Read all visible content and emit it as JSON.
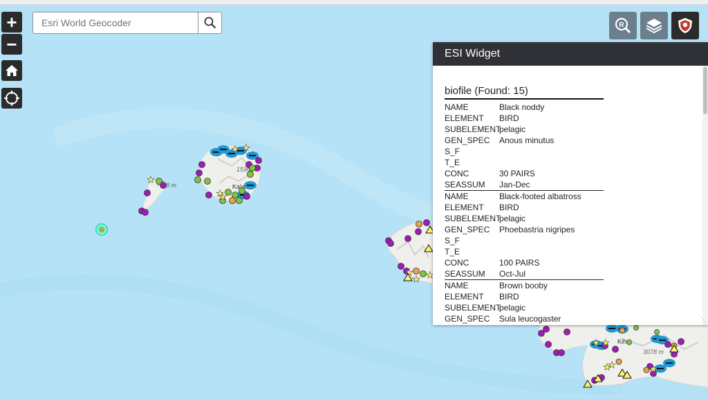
{
  "search": {
    "placeholder": "Esri World Geocoder"
  },
  "controls": {
    "zoom_in": "+",
    "zoom_out": "−"
  },
  "map_labels": {
    "elevation_1": "1596",
    "elevation_2": "98 m",
    "elevation_3": "3078 m",
    "town_1": "Kalal",
    "town_2": "Kihei",
    "town_3": "Ka"
  },
  "widget": {
    "title": "ESI Widget",
    "results_title": "biofile (Found: 15)",
    "records": [
      {
        "rows": [
          {
            "k": "NAME",
            "v": "Black noddy"
          },
          {
            "k": "ELEMENT",
            "v": "BIRD"
          },
          {
            "k": "SUBELEMENT",
            "v": "pelagic"
          },
          {
            "k": "GEN_SPEC",
            "v": "Anous minutus"
          },
          {
            "k": "S_F",
            "v": ""
          },
          {
            "k": "T_E",
            "v": ""
          },
          {
            "k": "CONC",
            "v": "30 PAIRS"
          },
          {
            "k": "SEASSUM",
            "v": "Jan-Dec"
          }
        ]
      },
      {
        "rows": [
          {
            "k": "NAME",
            "v": "Black-footed albatross"
          },
          {
            "k": "ELEMENT",
            "v": "BIRD"
          },
          {
            "k": "SUBELEMENT",
            "v": "pelagic"
          },
          {
            "k": "GEN_SPEC",
            "v": "Phoebastria nigripes"
          },
          {
            "k": "S_F",
            "v": ""
          },
          {
            "k": "T_E",
            "v": ""
          },
          {
            "k": "CONC",
            "v": "100 PAIRS"
          },
          {
            "k": "SEASSUM",
            "v": "Oct-Jul"
          }
        ]
      },
      {
        "rows": [
          {
            "k": "NAME",
            "v": "Brown booby"
          },
          {
            "k": "ELEMENT",
            "v": "BIRD"
          },
          {
            "k": "SUBELEMENT",
            "v": "pelagic"
          },
          {
            "k": "GEN_SPEC",
            "v": "Sula leucogaster"
          }
        ]
      }
    ]
  },
  "colors": {
    "ocean": "#b5e2f6",
    "land": "#f2f2ef",
    "marker_purple": "#a21ab8",
    "marker_green": "#7cc63c",
    "marker_blue": "#1e97d4",
    "marker_star": "#fff46a",
    "marker_orange": "#e8a04b",
    "selected": "#35e6c8",
    "panel_header": "#2f3136",
    "button_dark": "#2b2b2b",
    "button_gray": "#6b7f8c"
  }
}
